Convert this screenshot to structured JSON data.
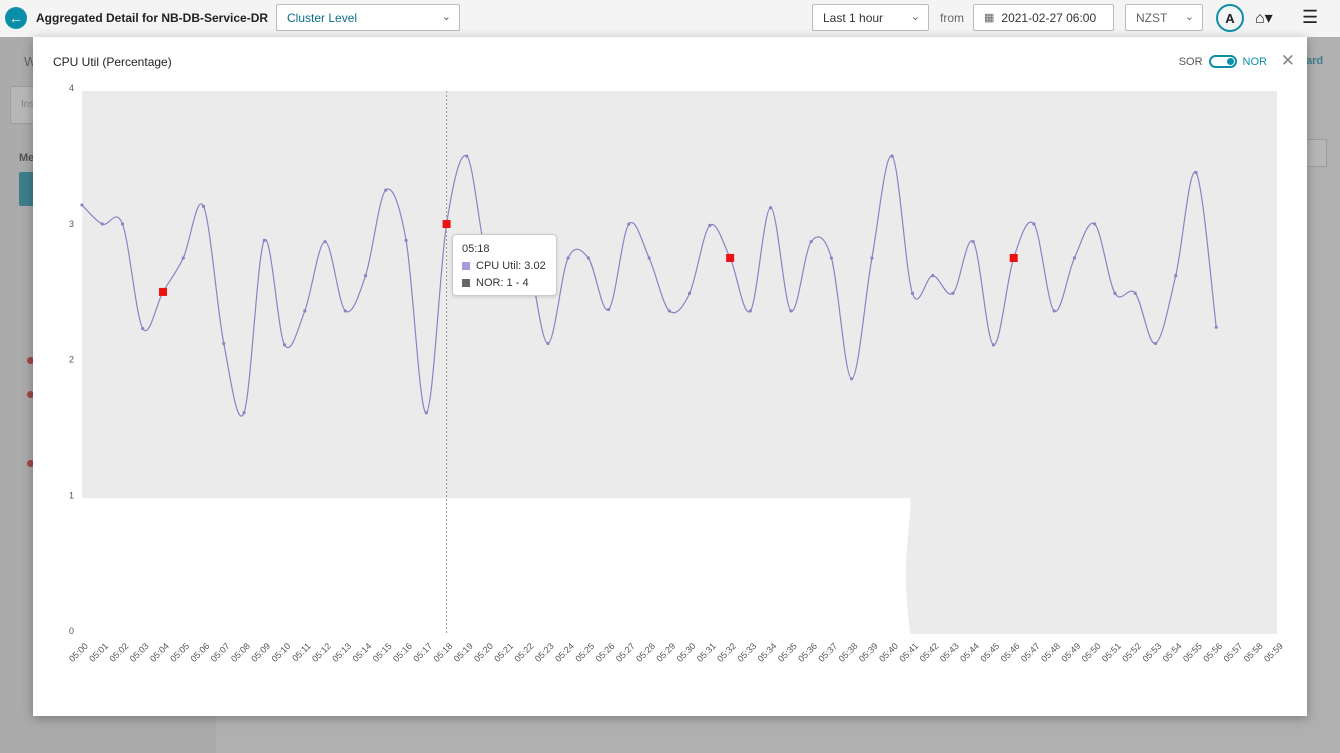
{
  "header": {
    "title": "Aggregated Detail for NB-DB-Service-DR",
    "level_select": "Cluster Level",
    "range_select": "Last 1 hour",
    "from_label": "from",
    "from_date": "2021-02-27 06:00",
    "timezone": "NZST",
    "avatar": "A"
  },
  "background": {
    "frag_w": "W",
    "frag_ins": "Ins",
    "frag_me": "Me",
    "frag_ard": "ard"
  },
  "modal": {
    "title": "CPU Util (Percentage)",
    "toggle_left": "SOR",
    "toggle_right": "NOR"
  },
  "tooltip": {
    "time": "05:18",
    "series_label": "CPU Util: 3.02",
    "band_label": "NOR: 1 - 4",
    "series_color": "#a89ad6",
    "band_color": "#666666"
  },
  "chart_data": {
    "type": "line",
    "ylim": [
      0,
      4
    ],
    "yticks": [
      0,
      1,
      2,
      3,
      4
    ],
    "x": [
      "05:00",
      "05:01",
      "05:02",
      "05:03",
      "05:04",
      "05:05",
      "05:06",
      "05:07",
      "05:08",
      "05:09",
      "05:10",
      "05:11",
      "05:12",
      "05:13",
      "05:14",
      "05:15",
      "05:16",
      "05:17",
      "05:18",
      "05:19",
      "05:20",
      "05:21",
      "05:22",
      "05:23",
      "05:24",
      "05:25",
      "05:26",
      "05:27",
      "05:28",
      "05:29",
      "05:30",
      "05:31",
      "05:32",
      "05:33",
      "05:34",
      "05:35",
      "05:36",
      "05:37",
      "05:38",
      "05:39",
      "05:40",
      "05:41",
      "05:42",
      "05:43",
      "05:44",
      "05:45",
      "05:46",
      "05:47",
      "05:48",
      "05:49",
      "05:50",
      "05:51",
      "05:52",
      "05:53",
      "05:54",
      "05:55",
      "05:56",
      "05:57",
      "05:58",
      "05:59"
    ],
    "series": [
      {
        "name": "CPU Util",
        "color": "#8c82c4",
        "values": [
          3.16,
          3.02,
          3.02,
          2.25,
          2.52,
          2.77,
          3.15,
          2.14,
          1.63,
          2.9,
          2.13,
          2.38,
          2.89,
          2.38,
          2.64,
          3.27,
          2.9,
          1.63,
          3.02,
          3.52,
          2.78,
          2.89,
          2.77,
          2.14,
          2.77,
          2.77,
          2.39,
          3.02,
          2.77,
          2.38,
          2.51,
          3.01,
          2.77,
          2.38,
          3.14,
          2.38,
          2.89,
          2.77,
          1.88,
          2.77,
          3.52,
          2.51,
          2.64,
          2.51,
          2.89,
          2.13,
          2.77,
          3.02,
          2.38,
          2.77,
          3.02,
          2.51,
          2.51,
          2.14,
          2.64,
          3.4,
          2.26,
          null,
          null,
          null
        ]
      }
    ],
    "anomalies": [
      "05:04",
      "05:18",
      "05:32",
      "05:46"
    ],
    "anomaly_color": "#ee1111",
    "band": {
      "name": "NOR",
      "lower": 1,
      "upper": 4,
      "lower_until": "05:41",
      "color": "#ebebeb"
    },
    "hover": "05:18"
  }
}
